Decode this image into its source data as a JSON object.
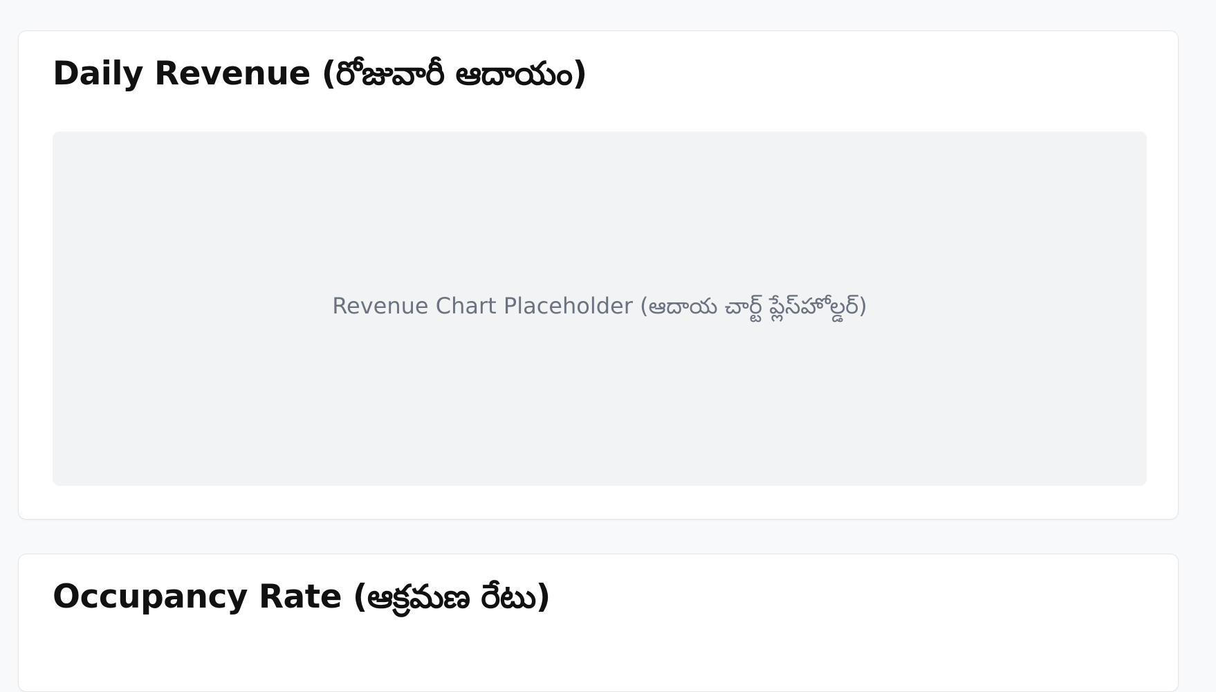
{
  "revenue_card": {
    "title": "Daily Revenue (రోజువారీ ఆదాయం)",
    "placeholder": "Revenue Chart Placeholder (ఆదాయ చార్ట్ ప్లేస్‌హోల్డర్)"
  },
  "occupancy_card": {
    "title": "Occupancy Rate (ఆక్రమణ రేటు)"
  },
  "colors": {
    "page_background": "#f8f9fa",
    "card_background": "#ffffff",
    "placeholder_background": "#f2f3f5",
    "placeholder_text": "#6b7280",
    "title_text": "#111111"
  }
}
